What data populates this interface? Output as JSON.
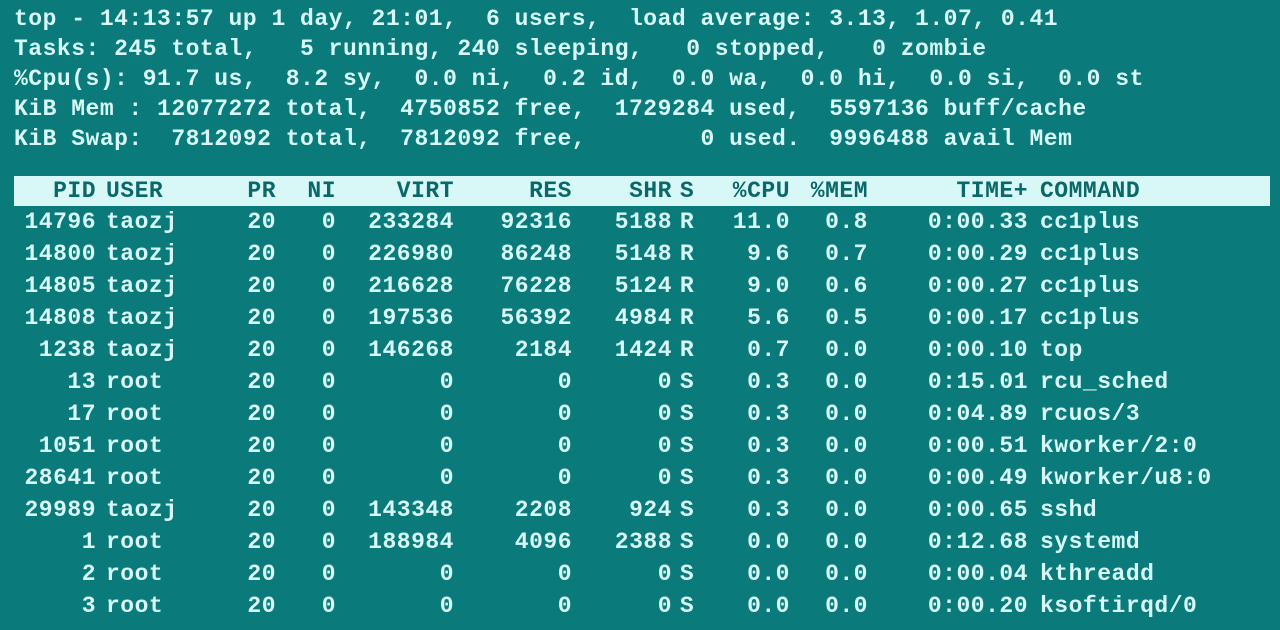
{
  "header": {
    "line1": "top - 14:13:57 up 1 day, 21:01,  6 users,  load average: 3.13, 1.07, 0.41",
    "line2": "Tasks: 245 total,   5 running, 240 sleeping,   0 stopped,   0 zombie",
    "line3": "%Cpu(s): 91.7 us,  8.2 sy,  0.0 ni,  0.2 id,  0.0 wa,  0.0 hi,  0.0 si,  0.0 st",
    "line4": "KiB Mem : 12077272 total,  4750852 free,  1729284 used,  5597136 buff/cache",
    "line5": "KiB Swap:  7812092 total,  7812092 free,        0 used.  9996488 avail Mem"
  },
  "columns": {
    "pid": "  PID",
    "user": "USER      ",
    "pr": "PR",
    "ni": "NI",
    "virt": "VIRT",
    "res": "RES",
    "shr": "SHR",
    "s": "S",
    "cpu": "%CPU",
    "mem": "%MEM",
    "time": "TIME+",
    "cmd": "COMMAND"
  },
  "rows": [
    {
      "pid": "14796",
      "user": "taozj",
      "pr": "20",
      "ni": "0",
      "virt": "233284",
      "res": "92316",
      "shr": "5188",
      "s": "R",
      "cpu": "11.0",
      "mem": "0.8",
      "time": "0:00.33",
      "cmd": "cc1plus",
      "bold": true
    },
    {
      "pid": "14800",
      "user": "taozj",
      "pr": "20",
      "ni": "0",
      "virt": "226980",
      "res": "86248",
      "shr": "5148",
      "s": "R",
      "cpu": "9.6",
      "mem": "0.7",
      "time": "0:00.29",
      "cmd": "cc1plus",
      "bold": true
    },
    {
      "pid": "14805",
      "user": "taozj",
      "pr": "20",
      "ni": "0",
      "virt": "216628",
      "res": "76228",
      "shr": "5124",
      "s": "R",
      "cpu": "9.0",
      "mem": "0.6",
      "time": "0:00.27",
      "cmd": "cc1plus",
      "bold": true
    },
    {
      "pid": "14808",
      "user": "taozj",
      "pr": "20",
      "ni": "0",
      "virt": "197536",
      "res": "56392",
      "shr": "4984",
      "s": "R",
      "cpu": "5.6",
      "mem": "0.5",
      "time": "0:00.17",
      "cmd": "cc1plus",
      "bold": true
    },
    {
      "pid": "1238",
      "user": "taozj",
      "pr": "20",
      "ni": "0",
      "virt": "146268",
      "res": "2184",
      "shr": "1424",
      "s": "R",
      "cpu": "0.7",
      "mem": "0.0",
      "time": "0:00.10",
      "cmd": "top",
      "bold": true
    },
    {
      "pid": "13",
      "user": "root",
      "pr": "20",
      "ni": "0",
      "virt": "0",
      "res": "0",
      "shr": "0",
      "s": "S",
      "cpu": "0.3",
      "mem": "0.0",
      "time": "0:15.01",
      "cmd": "rcu_sched",
      "bold": false
    },
    {
      "pid": "17",
      "user": "root",
      "pr": "20",
      "ni": "0",
      "virt": "0",
      "res": "0",
      "shr": "0",
      "s": "S",
      "cpu": "0.3",
      "mem": "0.0",
      "time": "0:04.89",
      "cmd": "rcuos/3",
      "bold": false
    },
    {
      "pid": "1051",
      "user": "root",
      "pr": "20",
      "ni": "0",
      "virt": "0",
      "res": "0",
      "shr": "0",
      "s": "S",
      "cpu": "0.3",
      "mem": "0.0",
      "time": "0:00.51",
      "cmd": "kworker/2:0",
      "bold": false
    },
    {
      "pid": "28641",
      "user": "root",
      "pr": "20",
      "ni": "0",
      "virt": "0",
      "res": "0",
      "shr": "0",
      "s": "S",
      "cpu": "0.3",
      "mem": "0.0",
      "time": "0:00.49",
      "cmd": "kworker/u8:0",
      "bold": false
    },
    {
      "pid": "29989",
      "user": "taozj",
      "pr": "20",
      "ni": "0",
      "virt": "143348",
      "res": "2208",
      "shr": "924",
      "s": "S",
      "cpu": "0.3",
      "mem": "0.0",
      "time": "0:00.65",
      "cmd": "sshd",
      "bold": false
    },
    {
      "pid": "1",
      "user": "root",
      "pr": "20",
      "ni": "0",
      "virt": "188984",
      "res": "4096",
      "shr": "2388",
      "s": "S",
      "cpu": "0.0",
      "mem": "0.0",
      "time": "0:12.68",
      "cmd": "systemd",
      "bold": false
    },
    {
      "pid": "2",
      "user": "root",
      "pr": "20",
      "ni": "0",
      "virt": "0",
      "res": "0",
      "shr": "0",
      "s": "S",
      "cpu": "0.0",
      "mem": "0.0",
      "time": "0:00.04",
      "cmd": "kthreadd",
      "bold": false
    },
    {
      "pid": "3",
      "user": "root",
      "pr": "20",
      "ni": "0",
      "virt": "0",
      "res": "0",
      "shr": "0",
      "s": "S",
      "cpu": "0.0",
      "mem": "0.0",
      "time": "0:00.20",
      "cmd": "ksoftirqd/0",
      "bold": false
    }
  ]
}
